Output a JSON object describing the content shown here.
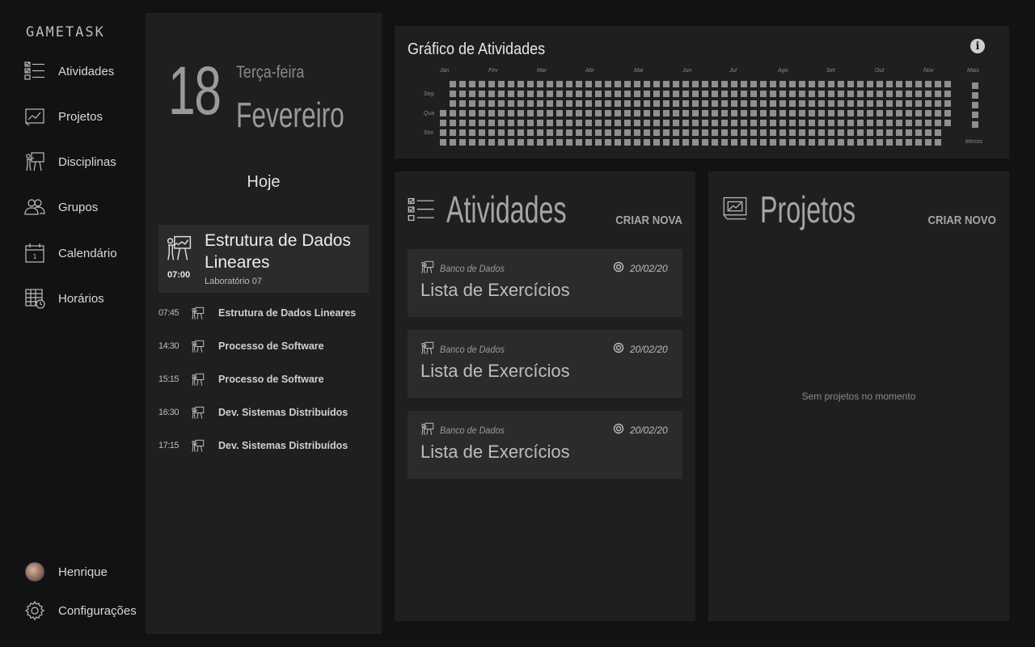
{
  "app": {
    "logo": "GAMETASK"
  },
  "sidebar": {
    "items": [
      {
        "label": "Atividades",
        "icon": "checklist-icon"
      },
      {
        "label": "Projetos",
        "icon": "chart-board-icon"
      },
      {
        "label": "Disciplinas",
        "icon": "teacher-board-icon"
      },
      {
        "label": "Grupos",
        "icon": "group-icon"
      },
      {
        "label": "Calendário",
        "icon": "calendar-icon"
      },
      {
        "label": "Horários",
        "icon": "schedule-icon"
      }
    ],
    "user": {
      "name": "Henrique"
    },
    "settings": {
      "label": "Configurações"
    }
  },
  "today": {
    "day": "18",
    "weekday": "Terça-feira",
    "month": "Fevereiro",
    "heading": "Hoje",
    "current": {
      "time": "07:00",
      "title": "Estrutura de Dados Lineares",
      "room": "Laboratório 07"
    },
    "schedule": [
      {
        "time": "07:45",
        "name": "Estrutura de Dados Lineares"
      },
      {
        "time": "14:30",
        "name": "Processo de Software"
      },
      {
        "time": "15:15",
        "name": "Processo de Software"
      },
      {
        "time": "16:30",
        "name": "Dev. Sistemas Distribuídos"
      },
      {
        "time": "17:15",
        "name": "Dev. Sistemas Distribuídos"
      }
    ]
  },
  "activity_graph": {
    "title": "Gráfico de Atividades",
    "months": [
      "Jan",
      "Fev",
      "Mar",
      "Abr",
      "Mai",
      "Jun",
      "Jul",
      "Ago",
      "Set",
      "Out",
      "Nov"
    ],
    "days": [
      "Seg",
      "Qua",
      "Sex"
    ],
    "legend_more": "Mais",
    "legend_less": "Menos"
  },
  "activities": {
    "title": "Atividades",
    "action": "CRIAR NOVA",
    "items": [
      {
        "subject": "Banco de Dados",
        "due": "20/02/20",
        "name": "Lista de Exercícios"
      },
      {
        "subject": "Banco de Dados",
        "due": "20/02/20",
        "name": "Lista de Exercícios"
      },
      {
        "subject": "Banco de Dados",
        "due": "20/02/20",
        "name": "Lista de Exercícios"
      }
    ]
  },
  "projects": {
    "title": "Projetos",
    "action": "CRIAR NOVO",
    "empty": "Sem projetos no momento"
  },
  "colors": {
    "background": "#121212",
    "panel": "#1f1f1f",
    "card": "#2b2b2b",
    "cell": "#8f8f8f"
  }
}
